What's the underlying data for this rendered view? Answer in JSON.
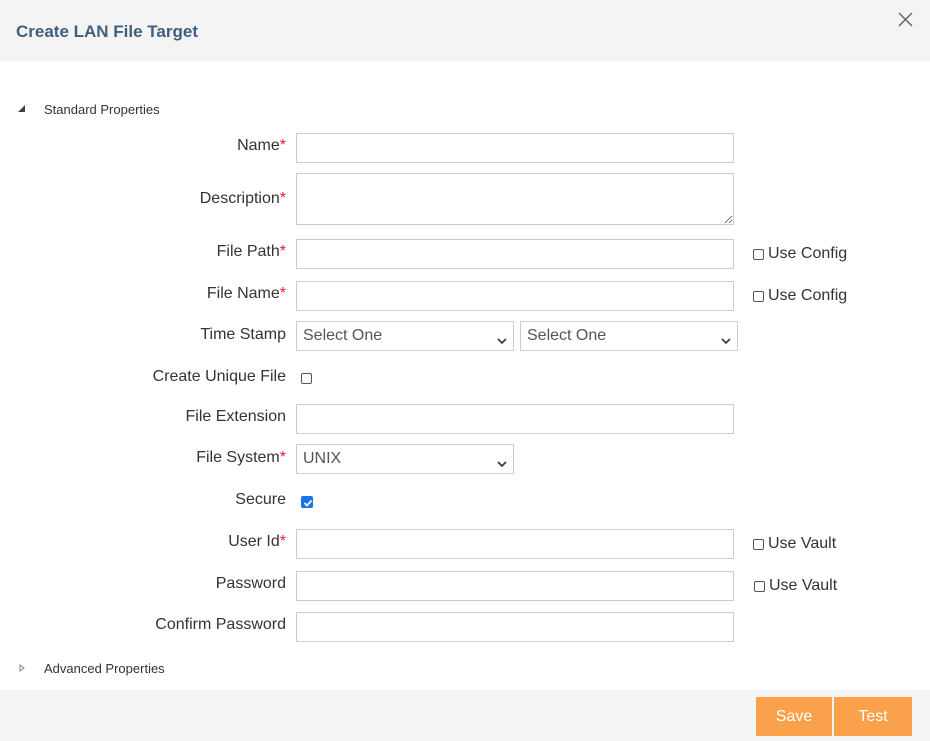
{
  "dialog": {
    "title": "Create LAN File Target"
  },
  "sections": {
    "standard": "Standard Properties",
    "advanced": "Advanced Properties"
  },
  "fields": {
    "name": {
      "label": "Name",
      "required": "*",
      "value": ""
    },
    "description": {
      "label": "Description",
      "required": "*",
      "value": ""
    },
    "file_path": {
      "label": "File Path",
      "required": "*",
      "value": "",
      "option": "Use Config"
    },
    "file_name": {
      "label": "File Name",
      "required": "*",
      "value": "",
      "option": "Use Config"
    },
    "time_stamp": {
      "label": "Time Stamp",
      "select1": "Select One",
      "select2": "Select One"
    },
    "create_unique_file": {
      "label": "Create Unique File",
      "checked": false
    },
    "file_extension": {
      "label": "File Extension",
      "value": ""
    },
    "file_system": {
      "label": "File System",
      "required": "*",
      "selected": "UNIX"
    },
    "secure": {
      "label": "Secure",
      "checked": true
    },
    "user_id": {
      "label": "User Id",
      "required": "*",
      "value": "",
      "option": "Use Vault"
    },
    "password": {
      "label": "Password",
      "value": "",
      "option": "Use Vault"
    },
    "confirm_password": {
      "label": "Confirm Password",
      "value": ""
    }
  },
  "buttons": {
    "save": "Save",
    "test": "Test"
  },
  "colors": {
    "title": "#3e5f7e",
    "required": "#d9232d",
    "button": "#fba14b",
    "header_bg": "#f4f4f4",
    "checkbox_checked": "#1a73e8"
  },
  "icons": {
    "close": "close-icon",
    "section_expanded": "caret-down-icon",
    "section_collapsed": "caret-right-icon",
    "select": "chevron-down-icon"
  }
}
